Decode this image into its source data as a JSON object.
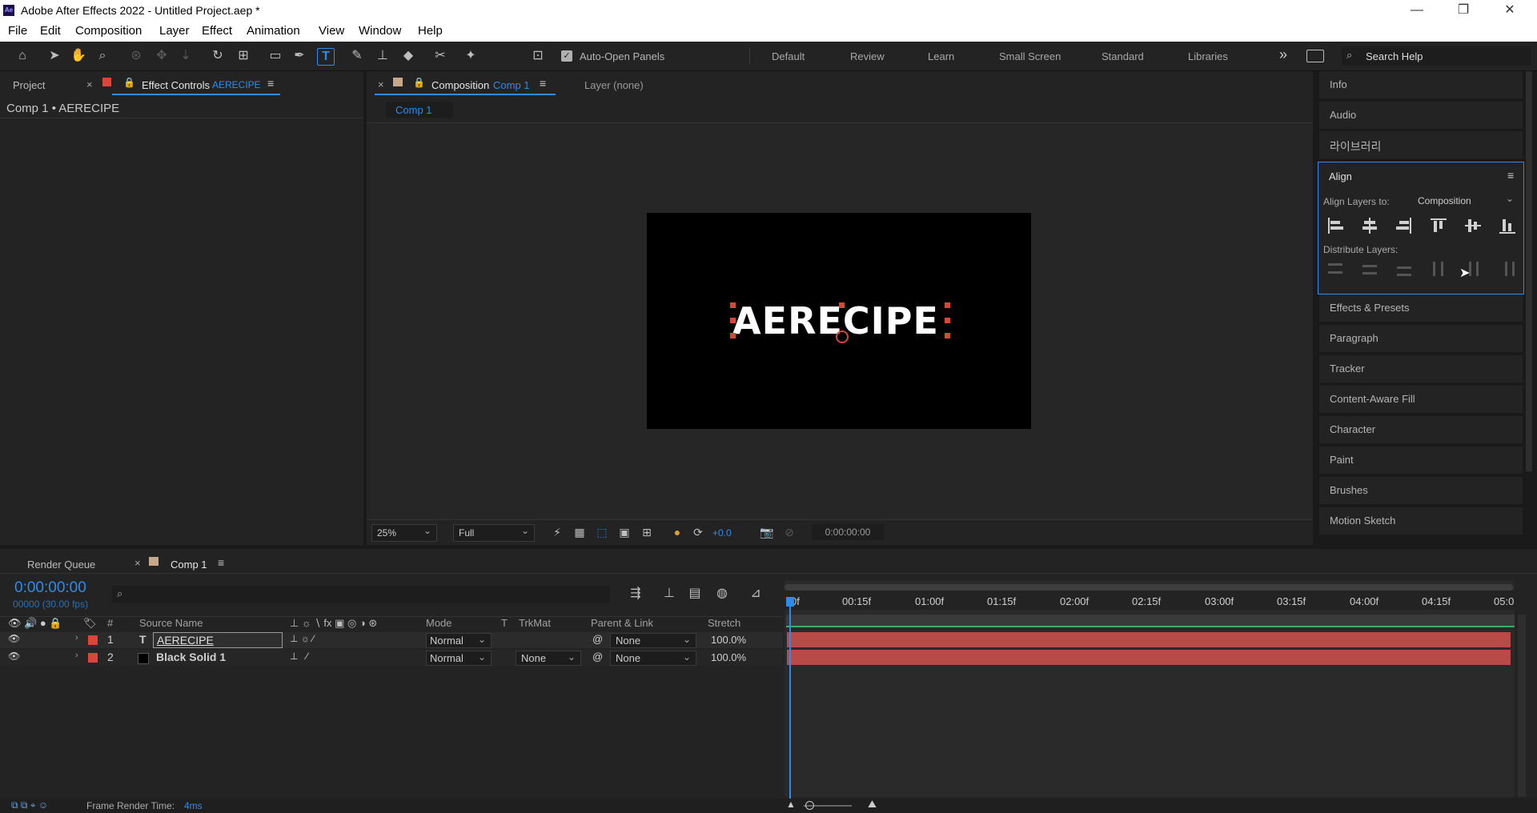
{
  "window": {
    "app_badge": "Ae",
    "title": "Adobe After Effects 2022 - Untitled Project.aep *",
    "minimize": "—",
    "restore": "❐",
    "close": "✕"
  },
  "menu": [
    "File",
    "Edit",
    "Composition",
    "Layer",
    "Effect",
    "Animation",
    "View",
    "Window",
    "Help"
  ],
  "toolbar": {
    "auto_open_label": "Auto-Open Panels",
    "workspaces": [
      "Default",
      "Review",
      "Learn",
      "Small Screen",
      "Standard",
      "Libraries"
    ],
    "overflow": "»",
    "search_placeholder": "Search Help"
  },
  "left_panel": {
    "tab_project": "Project",
    "tab_effect_controls": "Effect Controls",
    "effect_controls_layer": "AERECIPE",
    "breadcrumb": "Comp 1 • AERECIPE"
  },
  "comp_panel": {
    "tab_label": "Composition",
    "comp_name": "Comp 1",
    "layer_tab": "Layer (none)",
    "breadcrumb_tab": "Comp 1",
    "canvas_text": "AERECIPE",
    "zoom": "25%",
    "resolution": "Full",
    "exposure": "+0.0",
    "timecode": "0:00:00:00"
  },
  "right_panel": {
    "items_top": [
      "Info",
      "Audio",
      "라이브러리"
    ],
    "align": {
      "title": "Align",
      "align_to_label": "Align Layers to:",
      "align_to_value": "Composition",
      "distribute_label": "Distribute Layers:"
    },
    "items_bottom": [
      "Effects & Presets",
      "Paragraph",
      "Tracker",
      "Content-Aware Fill",
      "Character",
      "Paint",
      "Brushes",
      "Motion Sketch"
    ]
  },
  "timeline": {
    "tab_render_queue": "Render Queue",
    "tab_comp": "Comp 1",
    "current_time": "0:00:00:00",
    "frame_info": "00000 (30.00 fps)",
    "search_placeholder": "",
    "headers": {
      "num": "#",
      "source_name": "Source Name",
      "mode": "Mode",
      "t": "T",
      "trkmat": "TrkMat",
      "parent": "Parent & Link",
      "stretch": "Stretch"
    },
    "ruler": [
      "0f",
      "00:15f",
      "01:00f",
      "01:15f",
      "02:00f",
      "02:15f",
      "03:00f",
      "03:15f",
      "04:00f",
      "04:15f",
      "05:0"
    ],
    "layers": [
      {
        "num": "1",
        "type": "T",
        "name": "AERECIPE",
        "mode": "Normal",
        "trkmat": "",
        "parent": "None",
        "stretch": "100.0%",
        "label_color": "#d9463b"
      },
      {
        "num": "2",
        "type": "",
        "name": "Black Solid 1",
        "mode": "Normal",
        "trkmat": "None",
        "parent": "None",
        "stretch": "100.0%",
        "label_color": "#d9463b"
      }
    ],
    "status_prefix": "Frame Render Time:",
    "status_value": "4ms"
  },
  "colors": {
    "accent": "#2d8ceb",
    "label_red": "#d9463b",
    "bar_red": "#b84a47",
    "panel": "#232323"
  }
}
